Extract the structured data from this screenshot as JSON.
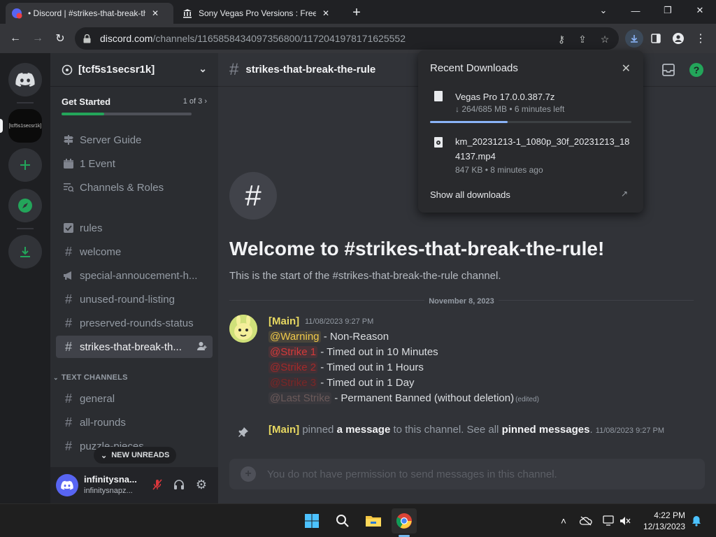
{
  "browser": {
    "tabs": [
      {
        "title": "• Discord | #strikes-that-break-the",
        "active": true,
        "favicon": "discord-red-badge-icon"
      },
      {
        "title": "Sony Vegas Pro Versions : Free D",
        "active": false,
        "favicon": "archive-building-icon"
      }
    ],
    "url_host": "discord.com",
    "url_path": "/channels/1165858434097356800/1172041978171625552"
  },
  "downloads": {
    "title": "Recent Downloads",
    "items": [
      {
        "name": "Vegas Pro 17.0.0.387.7z",
        "meta": "↓ 264/685 MB • 6 minutes left",
        "progress": 0.385
      },
      {
        "name": "km_20231213-1_1080p_30f_20231213_184137.mp4",
        "meta": "847 KB • 8 minutes ago"
      }
    ],
    "show_all": "Show all downloads"
  },
  "server": {
    "name": "[tcf5s1secsr1k]",
    "icon_text": "[tcf5s1secsr1k]",
    "get_started": {
      "label": "Get Started",
      "count": "1 of 3",
      "progress": 0.33
    },
    "nav": [
      {
        "label": "Server Guide",
        "icon": "signpost-icon"
      },
      {
        "label": "1 Event",
        "icon": "calendar-icon"
      },
      {
        "label": "Channels & Roles",
        "icon": "list-search-icon"
      }
    ],
    "channels": [
      {
        "label": "rules",
        "icon": "rules-checkbox-icon"
      },
      {
        "label": "welcome",
        "icon": "hash-icon"
      },
      {
        "label": "special-annoucement-h...",
        "icon": "megaphone-icon"
      },
      {
        "label": "unused-round-listing",
        "icon": "hash-icon"
      },
      {
        "label": "preserved-rounds-status",
        "icon": "hash-icon"
      },
      {
        "label": "strikes-that-break-th...",
        "icon": "hash-icon",
        "selected": true
      }
    ],
    "category": "TEXT CHANNELS",
    "text_channels": [
      {
        "label": "general"
      },
      {
        "label": "all-rounds"
      },
      {
        "label": "puzzle-pieces"
      }
    ],
    "new_unreads": "NEW UNREADS"
  },
  "user": {
    "name": "infinitysna...",
    "tag": "infinitysnapz..."
  },
  "channel": {
    "name": "strikes-that-break-the-rule",
    "welcome_title": "Welcome to #strikes-that-break-the-rule!",
    "welcome_sub": "This is the start of the #strikes-that-break-the-rule channel.",
    "date_divider": "November 8, 2023"
  },
  "message": {
    "author": "[Main]",
    "time": "11/08/2023 9:27 PM",
    "lines": [
      {
        "mention": "@Warning",
        "text": " - Non-Reason"
      },
      {
        "mention": "@Strike 1",
        "text": " - Timed out in 10 Minutes"
      },
      {
        "mention": "@Strike 2",
        "text": " - Timed out in 1 Hours"
      },
      {
        "mention": "@Strike 3",
        "text": " - Timed out in 1 Day"
      },
      {
        "mention": "@Last Strike",
        "text": " - Permanent Banned (without deletion)"
      }
    ],
    "edited": "(edited)"
  },
  "pin_notice": {
    "author": "[Main]",
    "t1": " pinned ",
    "link1": "a message",
    "t2": " to this channel. See all ",
    "link2": "pinned messages",
    "t3": ".",
    "time": "11/08/2023 9:27 PM"
  },
  "composer": {
    "placeholder": "You do not have permission to send messages in this channel."
  },
  "taskbar": {
    "time": "4:22 PM",
    "date": "12/13/2023"
  },
  "colors": {
    "discord_bg": "#313338",
    "sidebar_bg": "#2b2d31",
    "blurple": "#5865f2",
    "green": "#23a55a",
    "author_yellow": "#e7d861"
  }
}
